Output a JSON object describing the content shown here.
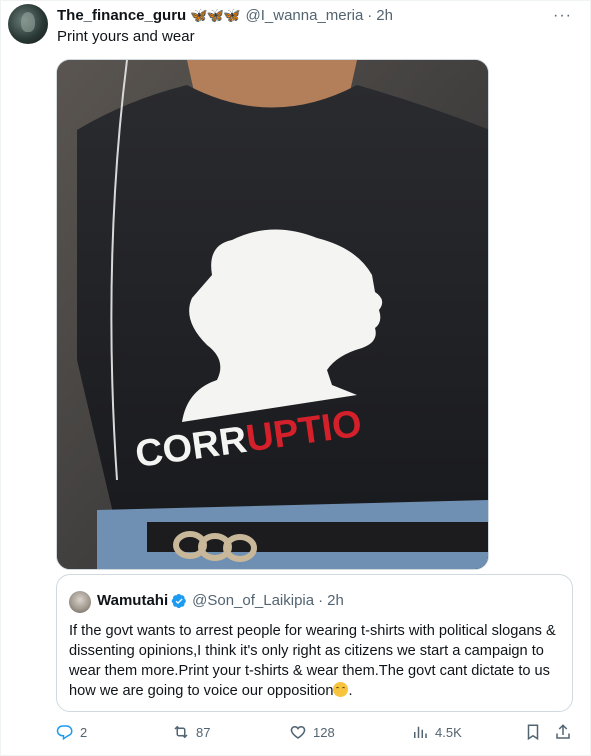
{
  "tweet": {
    "author_name": "The_finance_guru",
    "badges": "🦋🦋🦋",
    "handle": "@I_wanna_meria",
    "separator": "·",
    "time": "2h",
    "text": "Print yours and wear",
    "more_icon": "more-horizontal-icon"
  },
  "photo": {
    "shirt_text_black": "ORR",
    "shirt_text_red": "UPTIO",
    "shirt_text_c": "C",
    "colors": {
      "shirt": "#1e1f22",
      "silhouette": "#ffffff",
      "red": "#d4202a"
    }
  },
  "quote": {
    "author_name": "Wamutahi",
    "verified_icon": "verified-badge-icon",
    "handle": "@Son_of_Laikipia",
    "separator": "·",
    "time": "2h",
    "body": "If the govt wants to arrest people for wearing t-shirts with political slogans & dissenting opinions,I think it's only right as citizens we start a campaign to wear them more.Print your t-shirts & wear them.The govt cant dictate to us how we are going to voice our opposition",
    "emoji": "😌",
    "body_end": "."
  },
  "actions": {
    "replies": "2",
    "retweets": "87",
    "likes": "128",
    "views": "4.5K"
  },
  "colors": {
    "accent": "#1d9bf0",
    "muted": "#536471",
    "border": "#cfd9de"
  }
}
